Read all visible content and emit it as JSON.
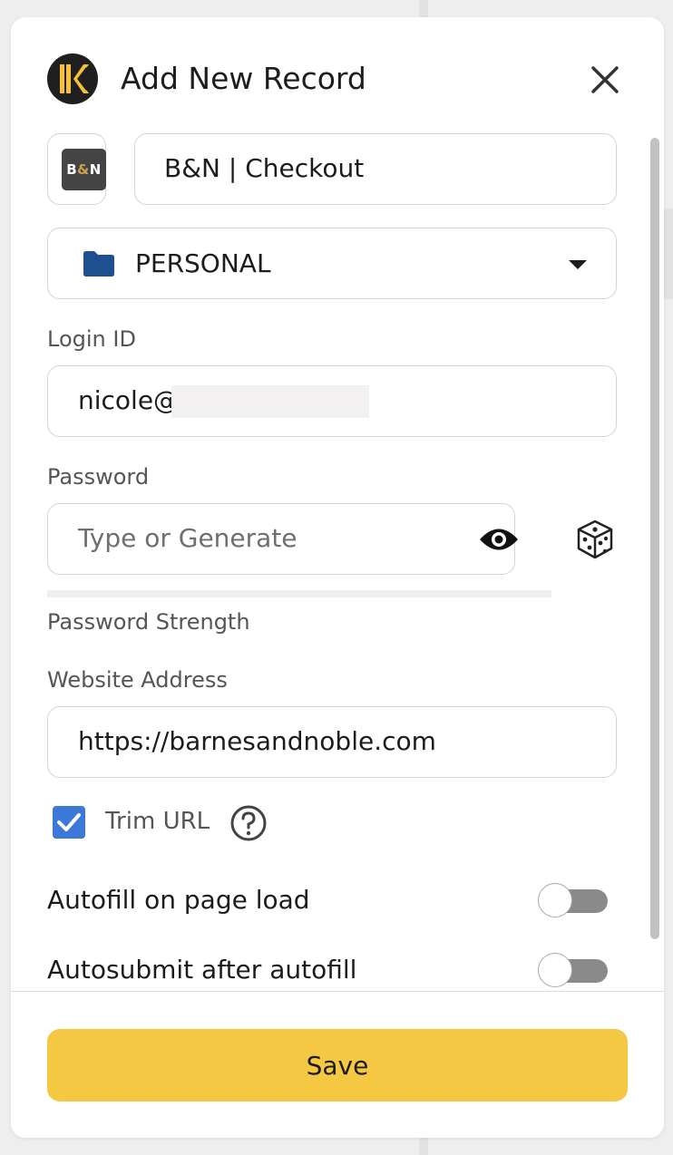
{
  "header": {
    "title": "Add New Record",
    "logo_icon": "keeper-logo-icon",
    "close_icon": "close-icon"
  },
  "record": {
    "brand_tile_text_b": "B",
    "brand_tile_text_amp": "&",
    "brand_tile_text_n": "N",
    "title_value": "B&N | Checkout"
  },
  "folder": {
    "selected": "PERSONAL",
    "icon": "folder-icon",
    "dropdown_icon": "caret-down-icon"
  },
  "login": {
    "label": "Login ID",
    "value": "nicole@"
  },
  "password": {
    "label": "Password",
    "placeholder": "Type or Generate",
    "strength_label": "Password Strength",
    "strength": 0,
    "visibility_icon": "eye-icon",
    "generate_icon": "dice-icon"
  },
  "website": {
    "label": "Website Address",
    "value": "https://barnesandnoble.com"
  },
  "trim_url": {
    "label": "Trim URL",
    "checked": true,
    "help_icon": "help-circle-icon"
  },
  "toggles": [
    {
      "label": "Autofill on page load",
      "on": false
    },
    {
      "label": "Autosubmit after autofill",
      "on": false
    }
  ],
  "footer": {
    "save_label": "Save"
  },
  "colors": {
    "accent_yellow": "#f5c844",
    "checkbox_blue": "#3b78d8",
    "folder_blue": "#1e4f91",
    "logo_dark": "#1f1f1f",
    "logo_gold": "#f6c136"
  }
}
